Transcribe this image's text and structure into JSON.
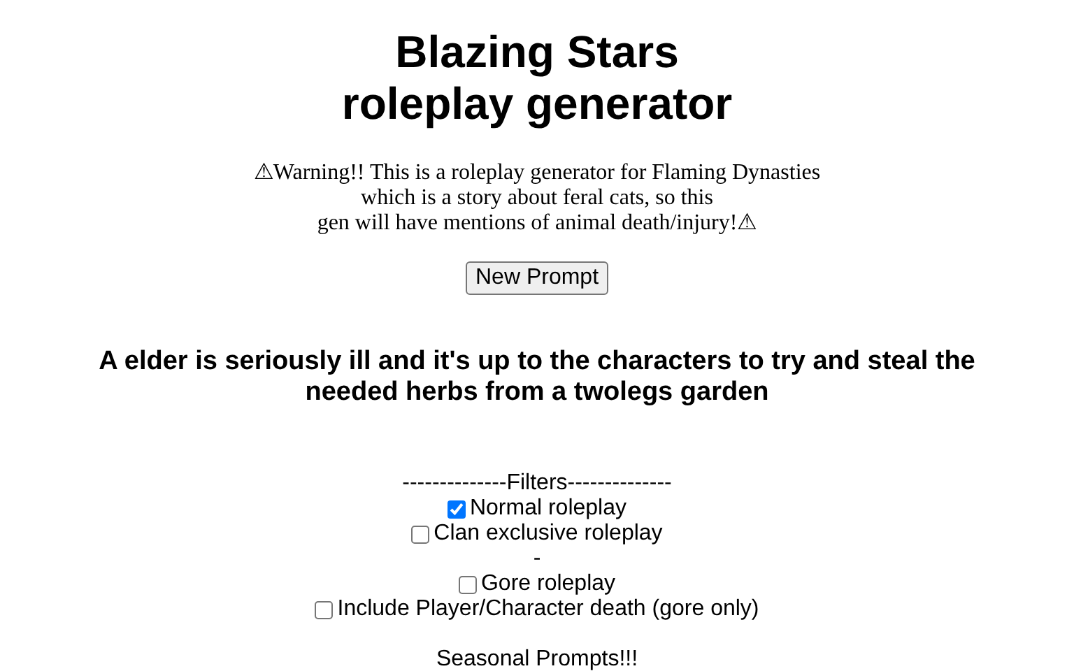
{
  "title": [
    "Blazing Stars",
    "roleplay generator"
  ],
  "warning": [
    "⚠Warning!! This is a roleplay generator for Flaming Dynasties",
    "which is a story about feral cats, so this",
    "gen will have mentions of animal death/injury!⚠"
  ],
  "button": "New Prompt",
  "prompt": "A elder is seriously ill and it's up to the characters to try and steal the needed herbs from a twolegs garden",
  "filters": [
    {
      "kind": "heading",
      "text": "--------------Filters--------------"
    },
    {
      "kind": "checkbox",
      "text": "Normal roleplay",
      "checked": true
    },
    {
      "kind": "checkbox",
      "text": "Clan exclusive roleplay",
      "checked": false
    },
    {
      "kind": "separator",
      "text": "-"
    },
    {
      "kind": "checkbox",
      "text": "Gore roleplay",
      "checked": false
    },
    {
      "kind": "checkbox",
      "text": "Include Player/Character death (gore only)",
      "checked": false
    },
    {
      "kind": "gap"
    },
    {
      "kind": "heading",
      "text": "Seasonal Prompts!!!"
    }
  ]
}
